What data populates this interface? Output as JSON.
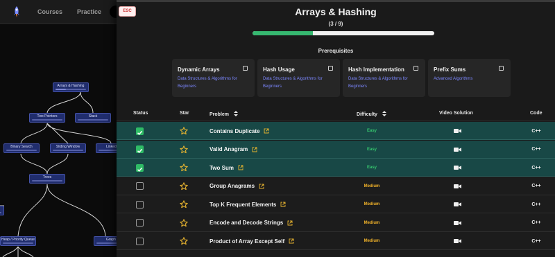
{
  "nav": {
    "links": [
      "Courses",
      "Practice"
    ]
  },
  "graph": {
    "nodes": [
      "Arrays & Hashing",
      "Two Pointers",
      "Stack",
      "Binary Search",
      "Sliding Window",
      "Linked",
      "Trees",
      "Heap / Priority Queue",
      "Graph"
    ]
  },
  "panel": {
    "esc_label": "ESC",
    "title": "Arrays & Hashing",
    "count": "(3 / 9)",
    "progress": 0.333,
    "prereq_heading": "Prerequisites",
    "prerequisites": [
      {
        "title": "Dynamic Arrays",
        "subtitle": "Data Structures & Algorithms for Beginners"
      },
      {
        "title": "Hash Usage",
        "subtitle": "Data Structures & Algorithms for Beginners"
      },
      {
        "title": "Hash Implementation",
        "subtitle": "Data Structures & Algorithms for Beginners"
      },
      {
        "title": "Prefix Sums",
        "subtitle": "Advanced Algorithms"
      }
    ]
  },
  "table": {
    "headers": {
      "status": "Status",
      "star": "Star",
      "problem": "Problem",
      "difficulty": "Difficulty",
      "video": "Video Solution",
      "code": "Code"
    },
    "rows": [
      {
        "done": true,
        "problem": "Contains Duplicate",
        "difficulty": "Easy",
        "code": "C++"
      },
      {
        "done": true,
        "problem": "Valid Anagram",
        "difficulty": "Easy",
        "code": "C++"
      },
      {
        "done": true,
        "problem": "Two Sum",
        "difficulty": "Easy",
        "code": "C++"
      },
      {
        "done": false,
        "problem": "Group Anagrams",
        "difficulty": "Medium",
        "code": "C++"
      },
      {
        "done": false,
        "problem": "Top K Frequent Elements",
        "difficulty": "Medium",
        "code": "C++"
      },
      {
        "done": false,
        "problem": "Encode and Decode Strings",
        "difficulty": "Medium",
        "code": "C++"
      },
      {
        "done": false,
        "problem": "Product of Array Except Self",
        "difficulty": "Medium",
        "code": "C++"
      }
    ]
  },
  "colors": {
    "accent_green": "#2fbb66",
    "done_row": "#184846",
    "easy": "#35c46d",
    "medium": "#f2b32a",
    "star": "#e9b52f",
    "link_blue": "#7c87ff"
  },
  "icons": {
    "logo": "rocket-icon",
    "star": "star-outline-icon",
    "external": "external-link-icon",
    "video": "video-camera-icon",
    "sort": "sort-icon"
  }
}
